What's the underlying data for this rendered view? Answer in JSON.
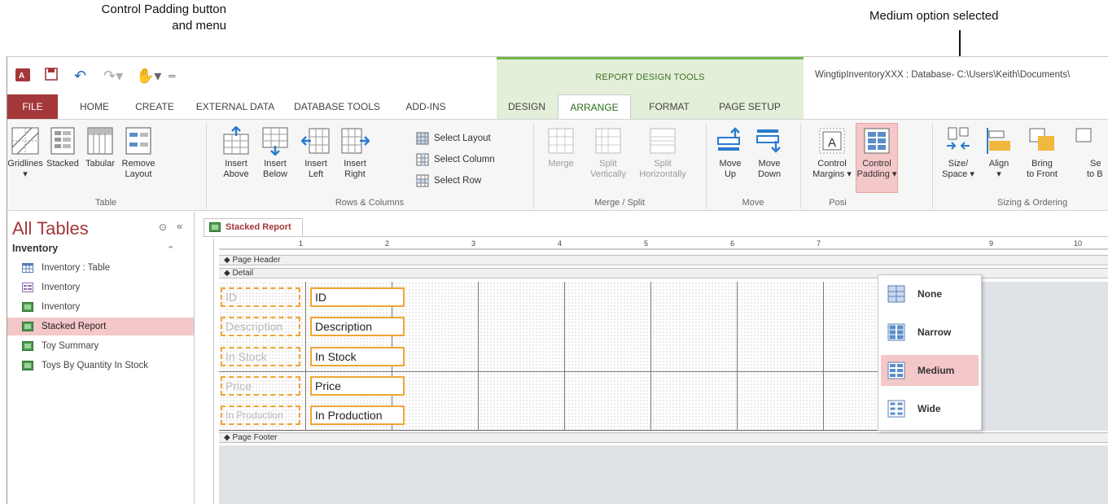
{
  "callouts": {
    "left_line1": "Control Padding button",
    "left_line2": "and menu",
    "right": "Medium option selected"
  },
  "titlebar": {
    "contextual_group": "REPORT DESIGN TOOLS",
    "window_title": "WingtipInventoryXXX : Database- C:\\Users\\Keith\\Documents\\"
  },
  "tabs": {
    "file": "FILE",
    "home": "HOME",
    "create": "CREATE",
    "external_data": "EXTERNAL DATA",
    "database_tools": "DATABASE TOOLS",
    "add_ins": "ADD-INS",
    "design": "DESIGN",
    "arrange": "ARRANGE",
    "format": "FORMAT",
    "page_setup": "PAGE SETUP"
  },
  "ribbon": {
    "table": {
      "label": "Table",
      "gridlines_1": "Gridlines",
      "gridlines_2": "▾",
      "stacked_1": "Stacked",
      "stacked_2": "",
      "tabular_1": "Tabular",
      "tabular_2": "",
      "remove_1": "Remove",
      "remove_2": "Layout"
    },
    "rows_columns": {
      "label": "Rows & Columns",
      "insert_above_1": "Insert",
      "insert_above_2": "Above",
      "insert_below_1": "Insert",
      "insert_below_2": "Below",
      "insert_left_1": "Insert",
      "insert_left_2": "Left",
      "insert_right_1": "Insert",
      "insert_right_2": "Right",
      "select_layout": "Select Layout",
      "select_column": "Select Column",
      "select_row": "Select Row"
    },
    "merge_split": {
      "label": "Merge / Split",
      "merge": "Merge",
      "split_v_1": "Split",
      "split_v_2": "Vertically",
      "split_h_1": "Split",
      "split_h_2": "Horizontally"
    },
    "move": {
      "label": "Move",
      "up_1": "Move",
      "up_2": "Up",
      "down_1": "Move",
      "down_2": "Down"
    },
    "position": {
      "label": "Posi",
      "margins_1": "Control",
      "margins_2": "Margins ▾",
      "padding_1": "Control",
      "padding_2": "Padding ▾"
    },
    "sizing": {
      "label": "Sizing & Ordering",
      "size_1": "Size/",
      "size_2": "Space ▾",
      "align_1": "Align",
      "align_2": "▾",
      "front_1": "Bring",
      "front_2": "to Front",
      "back_1": "Se",
      "back_2": "to B"
    }
  },
  "nav": {
    "title": "All Tables",
    "group": "Inventory",
    "items": [
      {
        "label": "Inventory : Table",
        "icon": "table-icon"
      },
      {
        "label": "Inventory",
        "icon": "form-icon"
      },
      {
        "label": "Inventory",
        "icon": "report-icon"
      },
      {
        "label": "Stacked Report",
        "icon": "report-icon"
      },
      {
        "label": "Toy Summary",
        "icon": "report-icon"
      },
      {
        "label": "Toys By Quantity In Stock",
        "icon": "report-icon"
      }
    ]
  },
  "document": {
    "tab": "Stacked Report",
    "ruler_marks": [
      "1",
      "2",
      "3",
      "4",
      "5",
      "6",
      "7",
      "9",
      "10"
    ],
    "page_header": "Page Header",
    "detail": "Detail",
    "page_footer": "Page Footer",
    "fields": [
      {
        "label": "ID",
        "value": "ID"
      },
      {
        "label": "Description",
        "value": "Description"
      },
      {
        "label": "In Stock",
        "value": "In Stock"
      },
      {
        "label": "Price",
        "value": "Price"
      },
      {
        "label": "In Production",
        "value": "In Production"
      }
    ]
  },
  "padding_menu": {
    "items": [
      {
        "label": "None",
        "key": "N"
      },
      {
        "label": "Narrow",
        "key": "a"
      },
      {
        "label": "Medium",
        "key": "M"
      },
      {
        "label": "Wide",
        "key": "W"
      }
    ],
    "selected": "Medium"
  },
  "colors": {
    "file_tab": "#a4373a",
    "accent_green": "#72b74c",
    "selection_pink": "#f4c7c8",
    "field_orange": "#f0a434"
  }
}
